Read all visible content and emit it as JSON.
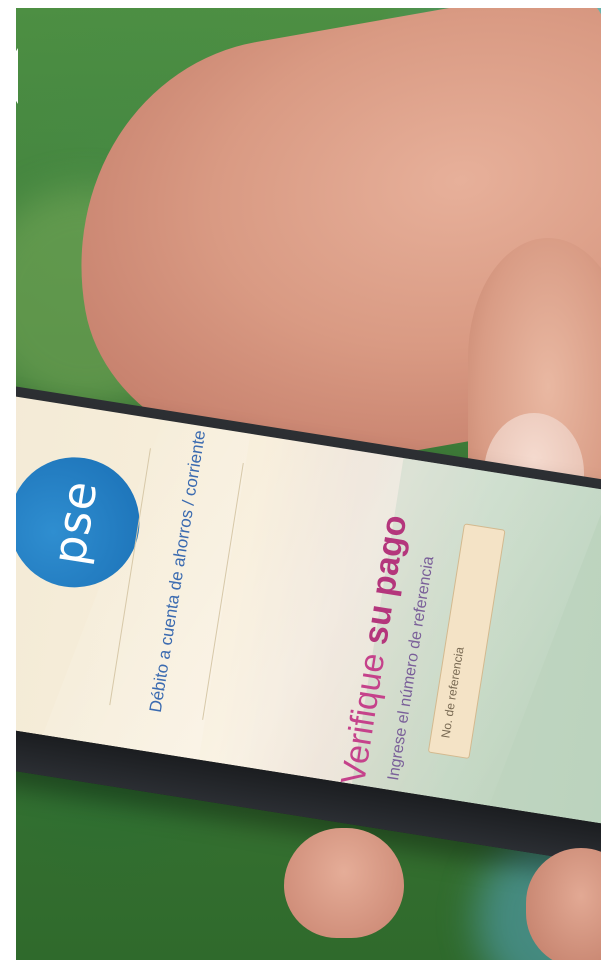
{
  "photo": {
    "scene": "hand-holding-phone",
    "colors": {
      "grass": "#3f7d3a",
      "skin": "#d99a83",
      "phone": "#1b1d20",
      "pse_blue": "#1a6fb5",
      "accent_magenta": "#c5428b"
    }
  },
  "screen": {
    "logo_text": "pse",
    "debit_line": "Débito a cuenta de ahorros / corriente",
    "headline_part1": "Verifique ",
    "headline_part2": "su pago",
    "subheadline": "Ingrese el número de referencia",
    "reference_placeholder": "No. de referencia"
  },
  "icons": {
    "back": "back-arrow-notch"
  }
}
